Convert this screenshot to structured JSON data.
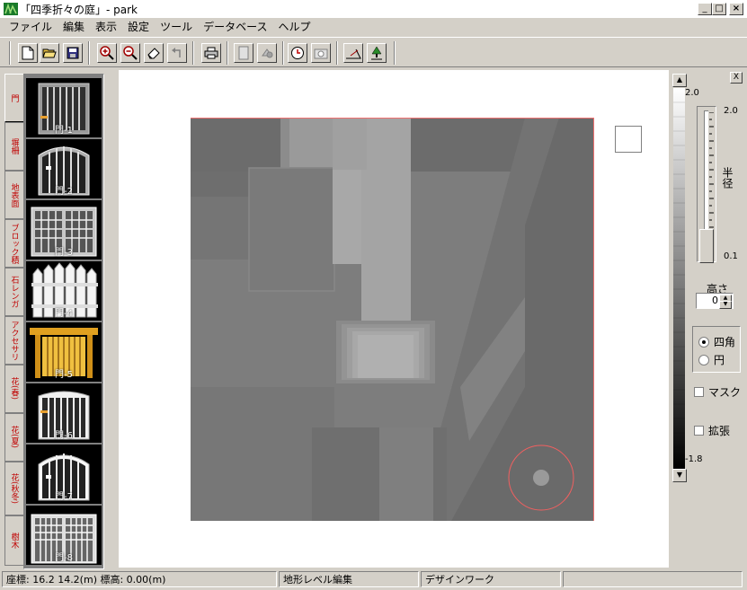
{
  "window": {
    "title": "「四季折々の庭」- park",
    "controls": [
      "minimize-icon",
      "maximize-icon",
      "close-icon"
    ]
  },
  "menu": [
    "ファイル",
    "編集",
    "表示",
    "設定",
    "ツール",
    "データベース",
    "ヘルプ"
  ],
  "toolbar": [
    "new-file-icon",
    "open-folder-icon",
    "save-icon",
    "zoom-in-icon",
    "zoom-out-icon",
    "eraser-icon",
    "undo-icon",
    "print-icon",
    "page-icon",
    "3d-view-icon",
    "clock-icon",
    "camera-icon",
    "terrain-tool-icon",
    "tree-person-icon"
  ],
  "categories": [
    "門",
    "塀柵",
    "地表面",
    "ブロック積",
    "石レンガ",
    "アクセサリ",
    "花(春)",
    "花(夏)",
    "花(秋冬)",
    "樹木"
  ],
  "thumbnails": [
    "門-1",
    "門-2",
    "門-3",
    "門-4",
    "門-5",
    "門-6",
    "門-7",
    "門-8"
  ],
  "scale": {
    "top": "2.0",
    "bottom": "-1.8"
  },
  "radius": {
    "label": "半径",
    "max": "2.0",
    "min": "0.1"
  },
  "height": {
    "label": "高さ",
    "value": "0"
  },
  "shape": {
    "square": "四角",
    "circle": "円",
    "selected": "square"
  },
  "mask_label": "マスク",
  "expand_label": "拡張",
  "close_panel": "X",
  "status": {
    "coords": "座標: 16.2 14.2(m)  標高: 0.00(m)",
    "mode": "地形レベル編集",
    "work": "デザインワーク"
  }
}
